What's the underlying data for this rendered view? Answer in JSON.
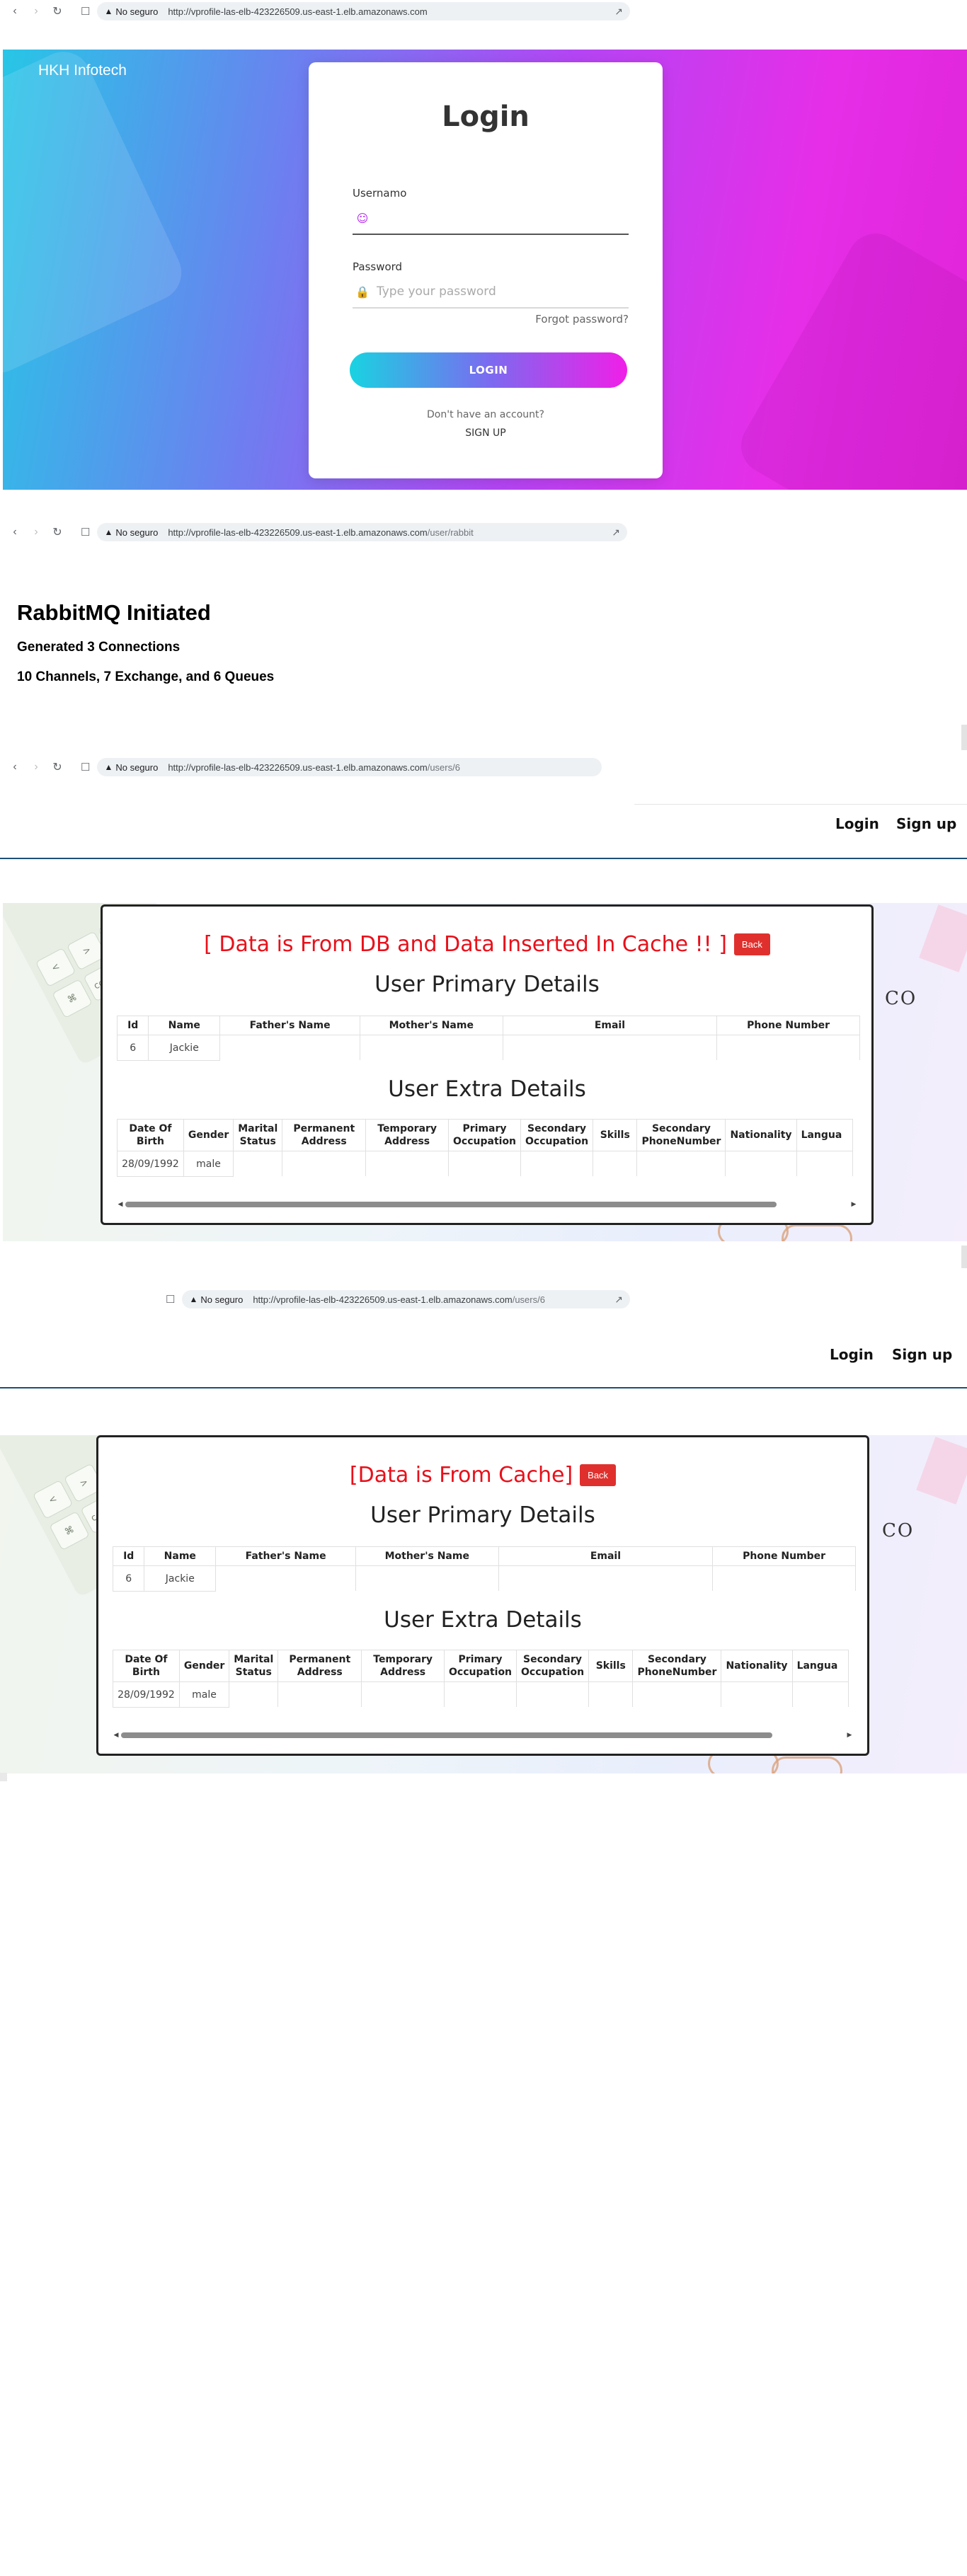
{
  "browser": {
    "security_label": "No seguro",
    "url1_host": "http://vprofile-las-elb-423226509.us-east-1.elb.amazonaws.com",
    "url1_path": "",
    "url2_host": "http://vprofile-las-elb-423226509.us-east-1.elb.amazonaws.com",
    "url2_path": "/user/rabbit",
    "url3_host": "http://vprofile-las-elb-423226509.us-east-1.elb.amazonaws.com",
    "url3_path": "/users/6",
    "url4_host": "http://vprofile-las-elb-423226509.us-east-1.elb.amazonaws.com",
    "url4_path": "/users/6"
  },
  "login": {
    "brand": "HKH Infotech",
    "title": "Login",
    "username_label": "Usernamo",
    "username_value": "",
    "password_label": "Password",
    "password_placeholder": "Type your password",
    "forgot": "Forgot password?",
    "button": "LOGIN",
    "no_account": "Don't have an account?",
    "signup": "SIGN UP"
  },
  "rabbit": {
    "title": "RabbitMQ Initiated",
    "line1": "Generated 3 Connections",
    "line2": "10 Channels, 7 Exchange, and 6 Queues"
  },
  "nav": {
    "login": "Login",
    "signup": "Sign up"
  },
  "deco": {
    "keys": [
      "⌘",
      "command",
      "<",
      ">",
      "?"
    ],
    "co": "CO"
  },
  "panel1": {
    "message": "[ Data is From DB and Data Inserted In Cache !! ]",
    "back": "Back"
  },
  "panel2": {
    "message": "[Data is From Cache]",
    "back": "Back"
  },
  "tables": {
    "primary_title": "User Primary Details",
    "primary_headers": [
      "Id",
      "Name",
      "Father's Name",
      "Mother's Name",
      "Email",
      "Phone Number"
    ],
    "primary_row": [
      "6",
      "Jackie",
      "",
      "",
      "",
      ""
    ],
    "extra_title": "User Extra Details",
    "extra_headers": [
      "Date Of Birth",
      "Gender",
      "Marital Status",
      "Permanent Address",
      "Temporary Address",
      "Primary Occupation",
      "Secondary Occupation",
      "Skills",
      "Secondary PhoneNumber",
      "Nationality",
      "Langua"
    ],
    "extra_row": [
      "28/09/1992",
      "male",
      "",
      "",
      "",
      "",
      "",
      "",
      "",
      "",
      ""
    ]
  },
  "colors": {
    "accent_red": "#e8101a",
    "navy_rule": "#1d4f7a",
    "login_gradient_start": "#19d3e1",
    "login_gradient_end": "#f01fe8"
  },
  "icons": {
    "back": "chevron-left-icon",
    "forward": "chevron-right-icon",
    "reload": "reload-icon",
    "bookmark": "bookmark-icon",
    "warning": "warning-icon",
    "share": "share-icon",
    "user": "user-icon",
    "lock": "lock-icon"
  }
}
